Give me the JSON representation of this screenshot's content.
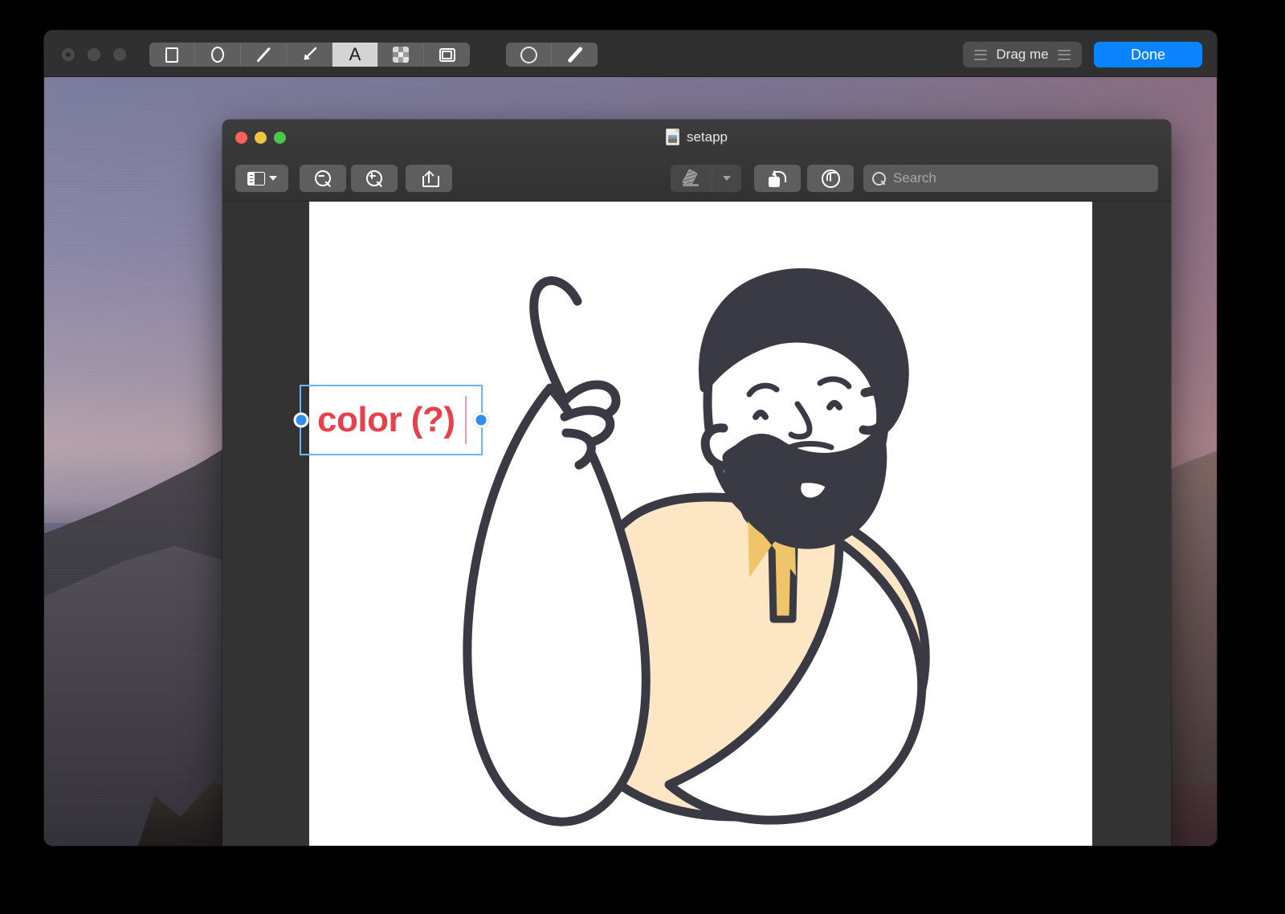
{
  "capture_window": {
    "traffic_lights": [
      "record-dot",
      "dot",
      "dot"
    ],
    "shape_tools": [
      {
        "name": "rectangle-tool",
        "icon": "rectangle-icon",
        "active": false
      },
      {
        "name": "ellipse-tool",
        "icon": "ellipse-icon",
        "active": false
      },
      {
        "name": "line-tool",
        "icon": "line-icon",
        "active": false
      },
      {
        "name": "arrow-tool",
        "icon": "arrow-icon",
        "active": false
      },
      {
        "name": "text-tool",
        "icon": "letter-a-icon",
        "label": "A",
        "active": true
      },
      {
        "name": "pixelate-tool",
        "icon": "pixelate-icon",
        "active": false
      },
      {
        "name": "highlight-frame-tool",
        "icon": "frame-icon",
        "active": false
      }
    ],
    "style_tools": [
      {
        "name": "color-swatch",
        "icon": "color-circle-icon",
        "color": "#e2464b"
      },
      {
        "name": "stroke-width-tool",
        "icon": "stroke-line-icon"
      }
    ],
    "drag_button": {
      "label": "Drag me",
      "icon": "grip-lines-icon"
    },
    "done_button": {
      "label": "Done",
      "color": "#0a84ff"
    }
  },
  "preview_window": {
    "title": "setapp",
    "title_icon": "image-document-icon",
    "traffic_lights": [
      {
        "name": "close",
        "color": "#ff6159"
      },
      {
        "name": "minimize",
        "color": "#efc33f"
      },
      {
        "name": "zoom",
        "color": "#4ec449"
      }
    ],
    "toolbar_left": [
      {
        "name": "sidebar-toggle-button",
        "icon": "sidebar-icon"
      },
      {
        "name": "zoom-out-button",
        "icon": "magnifier-minus-icon"
      },
      {
        "name": "zoom-in-button",
        "icon": "magnifier-plus-icon"
      },
      {
        "name": "share-button",
        "icon": "share-icon"
      }
    ],
    "toolbar_right": [
      {
        "name": "markup-button",
        "icon": "highlighter-pen-icon",
        "enabled": false
      },
      {
        "name": "markup-options-button",
        "icon": "chevron-down-icon",
        "enabled": false
      },
      {
        "name": "rotate-left-button",
        "icon": "rotate-left-icon"
      },
      {
        "name": "annotate-button",
        "icon": "markup-sign-icon"
      }
    ],
    "search": {
      "placeholder": "Search",
      "value": "",
      "icon": "search-icon"
    },
    "annotation": {
      "text": "color (?)",
      "text_color": "#e8414b",
      "selection_color": "#6cb5f0",
      "handle_color": "#2f8ef5",
      "has_caret": true
    },
    "canvas": {
      "background": "#ffffff",
      "illustration_name": "bearded-man-pointing-up-illustration",
      "colors": {
        "outline": "#3a3a45",
        "shirt": "#fce6c4",
        "placket": "#f0c46a",
        "skin": "#ffffff",
        "hair": "#3a3a45"
      }
    }
  }
}
